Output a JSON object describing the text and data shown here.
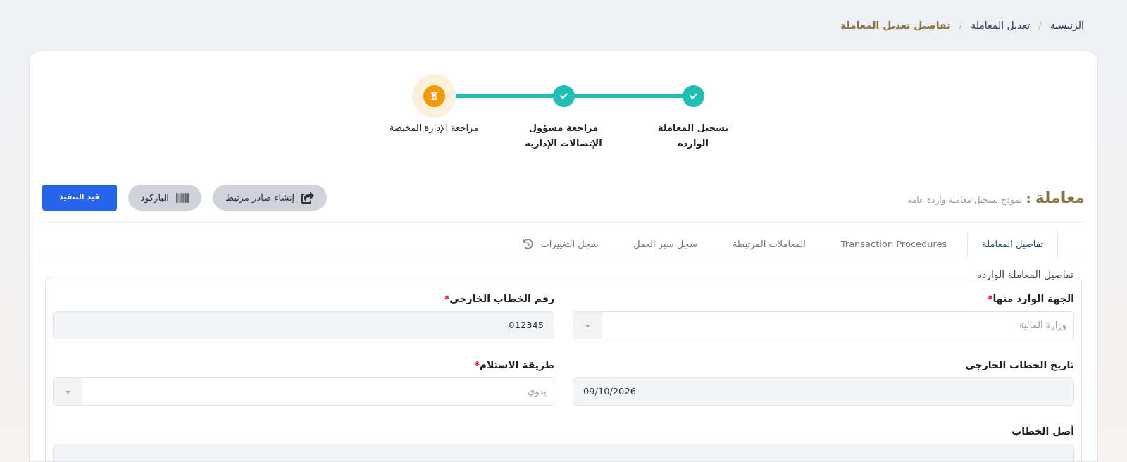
{
  "breadcrumb": {
    "separator": "/",
    "items": [
      {
        "label": "الرئيسية",
        "current": false
      },
      {
        "label": "تعديل المعاملة",
        "current": false
      },
      {
        "label": "تفاصيل تعديل المعاملة",
        "current": true
      }
    ]
  },
  "stepper": [
    {
      "lines": [
        "تسجيل المعاملة",
        "الواردة"
      ],
      "completed": true
    },
    {
      "lines": [
        "مراجعة مسؤول",
        "الإتصالات الإدارية"
      ],
      "completed": true
    },
    {
      "lines": [
        "مراجعة الإدارة المختصة"
      ],
      "completed": false
    }
  ],
  "header": {
    "title": "معاملة",
    "separator": ":",
    "subtitle": "نموذج تسجيل معاملة واردة عامة"
  },
  "actions": [
    {
      "label": "إنشاء صادر مرتبط",
      "kind": "share"
    },
    {
      "label": "الباركود",
      "kind": "barcode"
    },
    {
      "label": "قيد التنفيذ",
      "kind": "status"
    }
  ],
  "tabs": [
    {
      "label": "تفاصيل المعاملة",
      "selected": true,
      "icon": false
    },
    {
      "label": "Transaction Procedures",
      "selected": false,
      "icon": false
    },
    {
      "label": "المعاملات المرتبطة",
      "selected": false,
      "icon": false
    },
    {
      "label": "سجل سير العمل",
      "selected": false,
      "icon": false
    },
    {
      "label": "سجل التغييرات",
      "selected": false,
      "icon": true
    }
  ],
  "section": {
    "legend": "تفاصيل المعاملة الواردة",
    "required_mark": "*",
    "fields": [
      {
        "label": "الجهة الوارد منها",
        "required": true,
        "kind": "select",
        "placeholder": "وزارة المالية"
      },
      {
        "label": "رقم الخطاب الخارجي",
        "required": true,
        "kind": "readonly",
        "value": "012345"
      },
      {
        "label": "تاريخ الخطاب الخارجي",
        "required": false,
        "kind": "date",
        "value": "09/10/2026"
      },
      {
        "label": "طريقة الاستلام",
        "required": true,
        "kind": "select",
        "placeholder": "يدوي"
      },
      {
        "label": "أصل الخطاب",
        "required": false,
        "kind": "wide"
      }
    ]
  }
}
